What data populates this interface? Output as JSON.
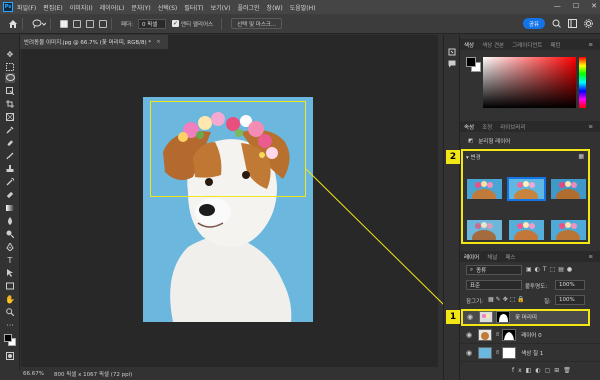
{
  "menubar": {
    "app_logo": "Ps",
    "items": [
      "파일(F)",
      "편집(E)",
      "이미지(I)",
      "레이어(L)",
      "문자(Y)",
      "선택(S)",
      "필터(T)",
      "보기(V)",
      "플러그인",
      "창(W)",
      "도움말(H)"
    ],
    "win": [
      "—",
      "☐",
      "✕"
    ]
  },
  "options": {
    "feather_label": "페더:",
    "feather_value": "0 픽셀",
    "antialias_label": "앤티 앨리어스",
    "select_mask_label": "선택 및 마스크...",
    "share_label": "공유"
  },
  "document": {
    "tab_title": "반려동물 이미지.jpg @ 66.7% (꽃 머리띠, RGB/8) *",
    "close": "×"
  },
  "status": {
    "zoom": "66.67%",
    "info": "800 픽셀 x 1067 픽셀 (72 ppi)"
  },
  "panels": {
    "color_tabs": [
      "색상",
      "색상 견본",
      "그레이디언트",
      "패턴"
    ],
    "props_tabs": [
      "속성",
      "조정",
      "라이브러리"
    ],
    "props_sub": "분리형 레이어",
    "presets_label": "변경",
    "layers_tabs": [
      "레이어",
      "채널",
      "패스"
    ],
    "kind_label": "종류",
    "blend_mode": "표준",
    "opacity_label": "불투명도:",
    "opacity_value": "100%",
    "lock_label": "잠그기:",
    "fill_label": "칠:",
    "fill_value": "100%",
    "layers": [
      {
        "name": "꽃 머리띠",
        "selected": true
      },
      {
        "name": "레이어 0",
        "selected": false
      },
      {
        "name": "색상 칠 1",
        "selected": false
      }
    ]
  },
  "callouts": [
    "1",
    "2"
  ],
  "colors": {
    "highlight": "#f2e617",
    "accent": "#1473e6",
    "photo_bg": "#6bb7dd"
  }
}
